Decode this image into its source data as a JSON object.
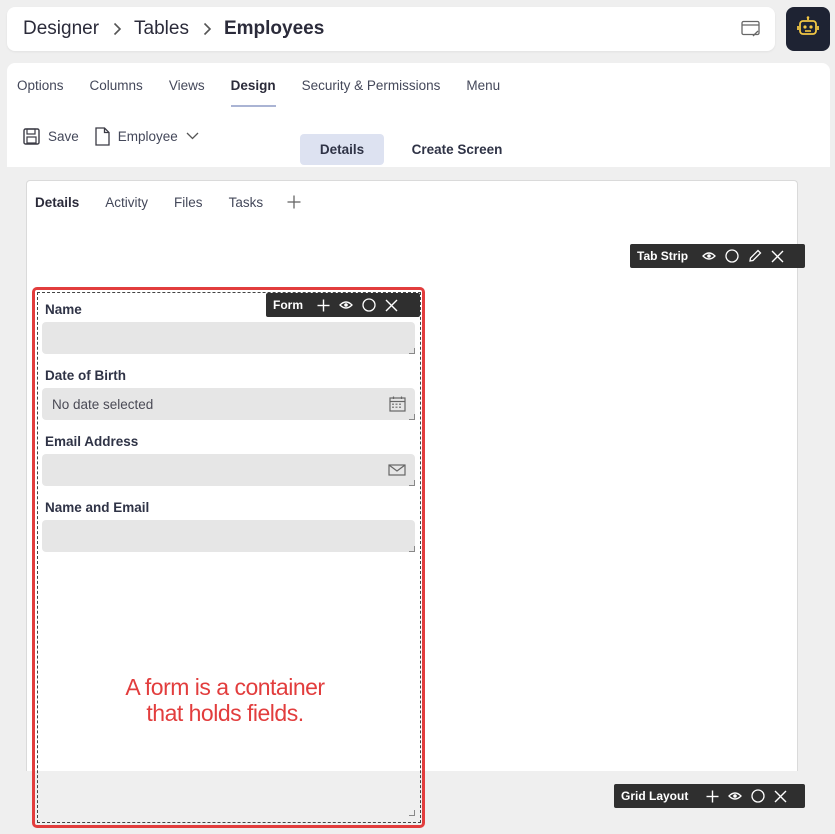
{
  "breadcrumb": {
    "items": [
      "Designer",
      "Tables"
    ],
    "current": "Employees"
  },
  "tabs": [
    "Options",
    "Columns",
    "Views",
    "Design",
    "Security & Permissions",
    "Menu"
  ],
  "active_tab": "Design",
  "toolbar": {
    "save_label": "Save",
    "document_label": "Employee"
  },
  "segments": {
    "details": "Details",
    "create_screen": "Create Screen"
  },
  "inner_tabs": [
    "Details",
    "Activity",
    "Files",
    "Tasks"
  ],
  "chips": {
    "tab_strip": "Tab Strip",
    "form": "Form",
    "grid_layout": "Grid Layout"
  },
  "fields": [
    {
      "label": "Name",
      "value": ""
    },
    {
      "label": "Date of Birth",
      "value": "No date selected"
    },
    {
      "label": "Email Address",
      "value": ""
    },
    {
      "label": "Name and Email",
      "value": ""
    }
  ],
  "callout": {
    "line1": "A form is a container",
    "line2": "that holds fields."
  },
  "colors": {
    "accent_outline": "#e23d3d",
    "active_segment": "#dde2f1",
    "dark_button": "#1e2333"
  }
}
